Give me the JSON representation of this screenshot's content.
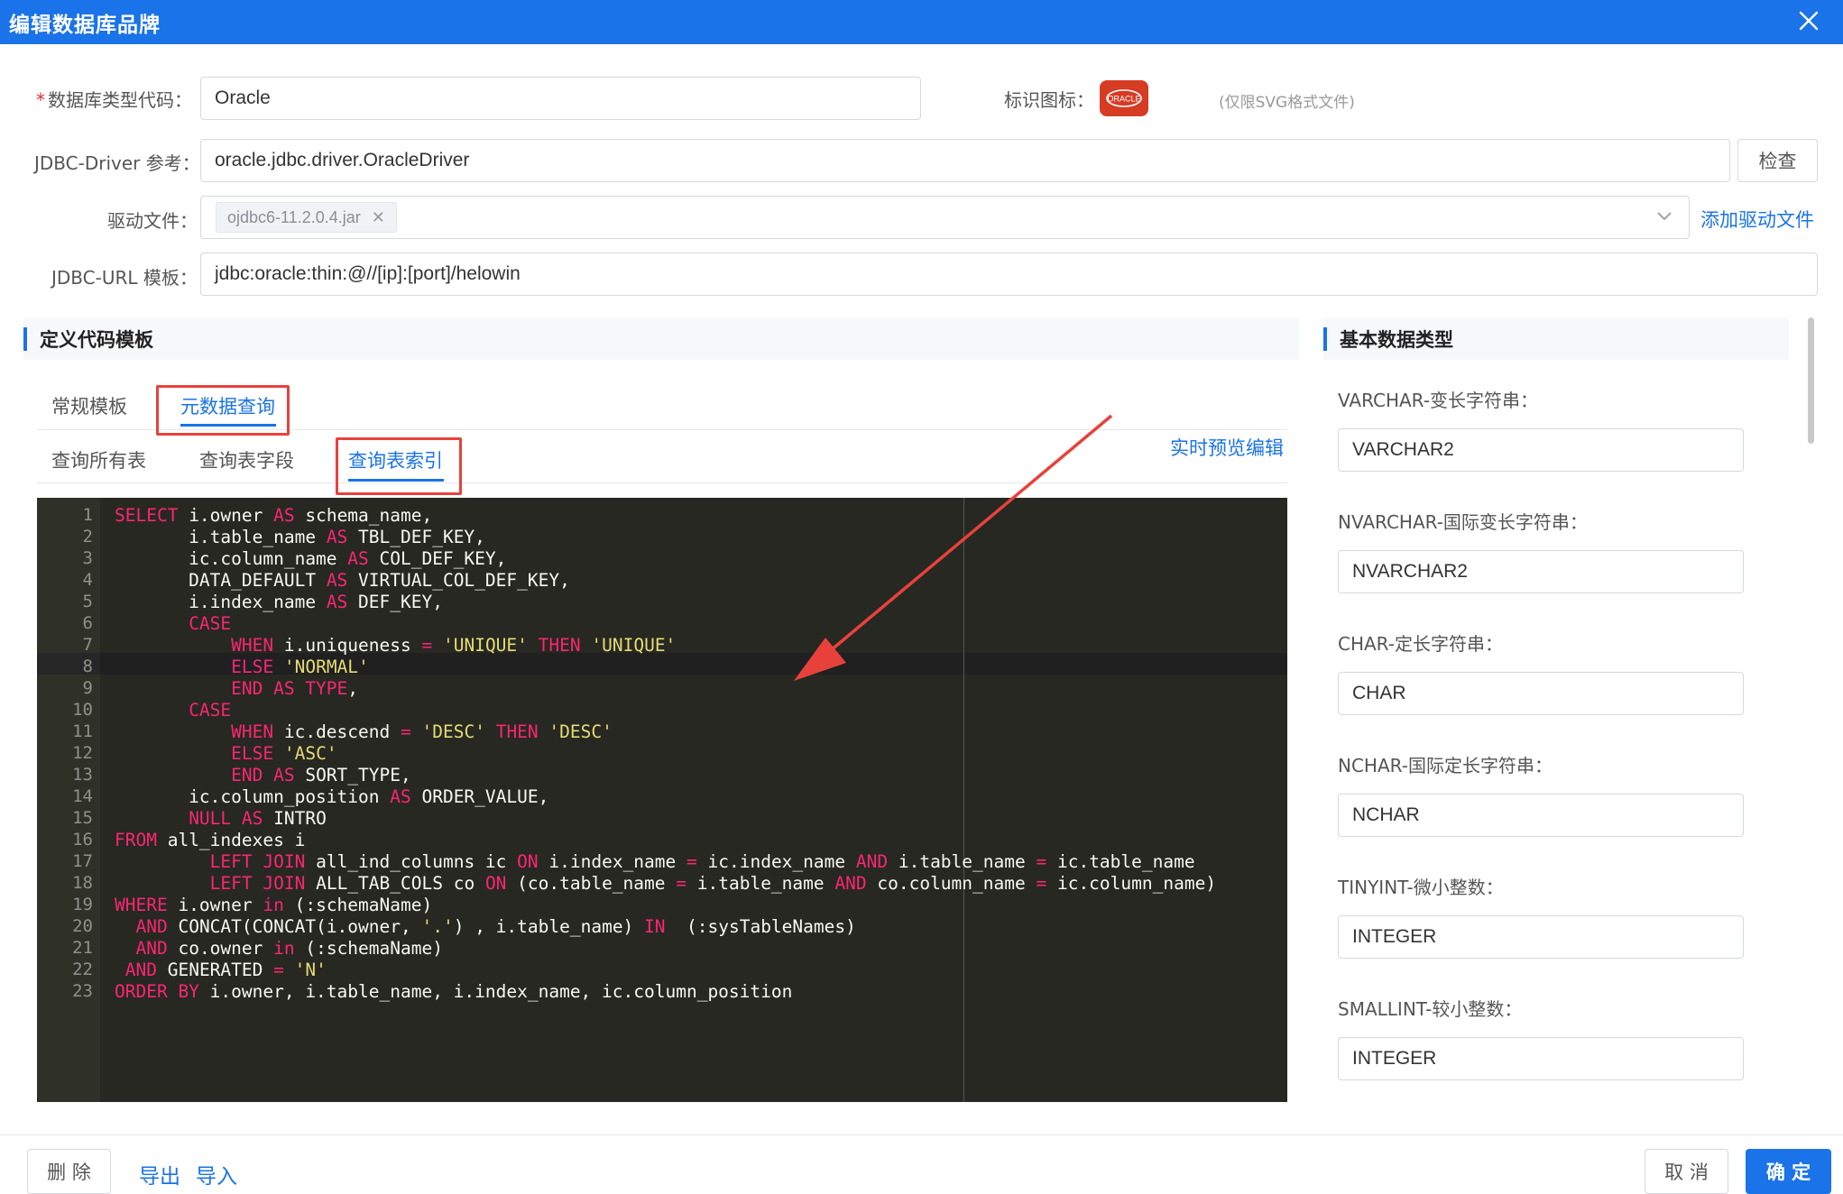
{
  "dialog": {
    "title": "编辑数据库品牌"
  },
  "form": {
    "db_type": {
      "label": "数据库类型代码：",
      "required_mark": "*",
      "value": "Oracle"
    },
    "icon": {
      "label": "标识图标：",
      "icon_text": "ORACLE",
      "hint": "(仅限SVG格式文件)"
    },
    "jdbc_driver": {
      "label": "JDBC-Driver 参考：",
      "value": "oracle.jdbc.driver.OracleDriver",
      "check_label": "检查"
    },
    "driver_file": {
      "label": "驱动文件：",
      "tag": "ojdbc6-11.2.0.4.jar",
      "add_label": "添加驱动文件"
    },
    "jdbc_url": {
      "label": "JDBC-URL 模板：",
      "value": "jdbc:oracle:thin:@//[ip]:[port]/helowin"
    }
  },
  "code_section": {
    "title": "定义代码模板",
    "tabs": [
      "常规模板",
      "元数据查询"
    ],
    "subtabs": [
      "查询所有表",
      "查询表字段",
      "查询表索引"
    ],
    "preview_link": "实时预览编辑",
    "line_numbers": [
      "1",
      "2",
      "3",
      "4",
      "5",
      "6",
      "7",
      "8",
      "9",
      "10",
      "11",
      "12",
      "13",
      "14",
      "15",
      "16",
      "17",
      "18",
      "19",
      "20",
      "21",
      "22",
      "23"
    ]
  },
  "data_types": {
    "title": "基本数据类型",
    "items": [
      {
        "label": "VARCHAR-变长字符串：",
        "value": "VARCHAR2"
      },
      {
        "label": "NVARCHAR-国际变长字符串：",
        "value": "NVARCHAR2"
      },
      {
        "label": "CHAR-定长字符串：",
        "value": "CHAR"
      },
      {
        "label": "NCHAR-国际定长字符串：",
        "value": "NCHAR"
      },
      {
        "label": "TINYINT-微小整数：",
        "value": "INTEGER"
      },
      {
        "label": "SMALLINT-较小整数：",
        "value": "INTEGER"
      }
    ]
  },
  "footer": {
    "delete": "删 除",
    "export": "导出",
    "import": "导入",
    "cancel": "取 消",
    "confirm": "确 定"
  },
  "colors": {
    "accent": "#1a73e8",
    "annotation": "#e8413c",
    "editor_bg": "#272822",
    "keyword": "#f92672",
    "string": "#e6db74"
  }
}
